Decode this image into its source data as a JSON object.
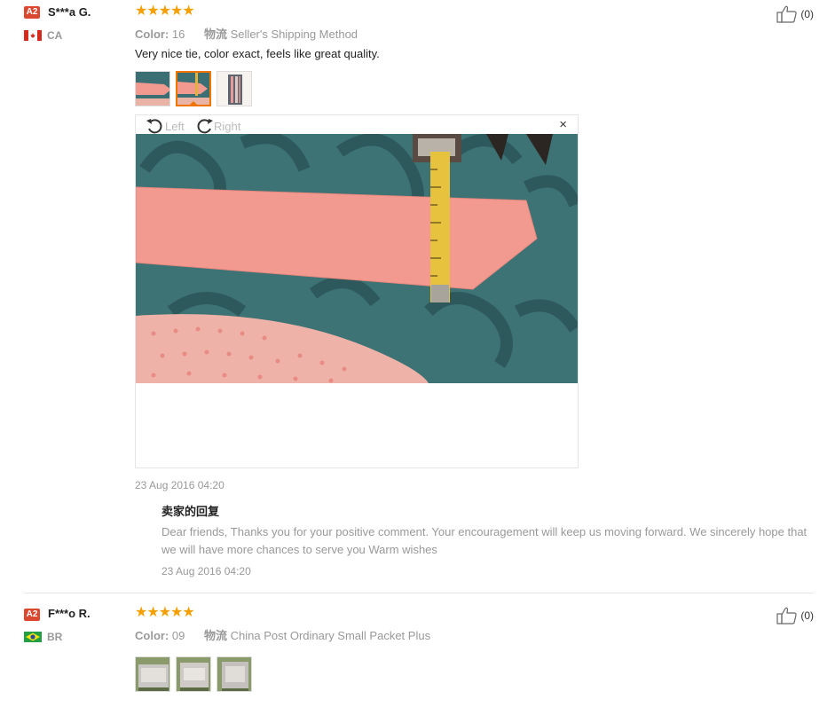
{
  "reviews": [
    {
      "badge": "A2",
      "username": "S***a G.",
      "country": "CA",
      "stars": "★★★★★",
      "color_label": "Color:",
      "color_value": "16",
      "shipping_label": "物流",
      "shipping_value": "Seller's Shipping Method",
      "text": "Very nice tie, color exact, feels like great quality.",
      "likes": "(0)",
      "date": "23 Aug 2016 04:20",
      "photo_viewer": {
        "rotate_left": "Left",
        "rotate_right": "Right",
        "close": "×"
      },
      "seller_reply": {
        "title": "卖家的回复",
        "text": "Dear friends, Thanks you for your positive comment. Your encouragement will keep us moving forward. We sincerely hope that we will have more chances to serve you Warm wishes",
        "date": "23 Aug 2016 04:20"
      }
    },
    {
      "badge": "A2",
      "username": "F***o R.",
      "country": "BR",
      "stars": "★★★★★",
      "color_label": "Color:",
      "color_value": "09",
      "shipping_label": "物流",
      "shipping_value": "China Post Ordinary Small Packet Plus",
      "likes": "(0)"
    }
  ],
  "colors": {
    "star": "#f5a000",
    "badge": "#d9482f",
    "active_thumb": "#f07500",
    "muted_text": "#999999"
  }
}
